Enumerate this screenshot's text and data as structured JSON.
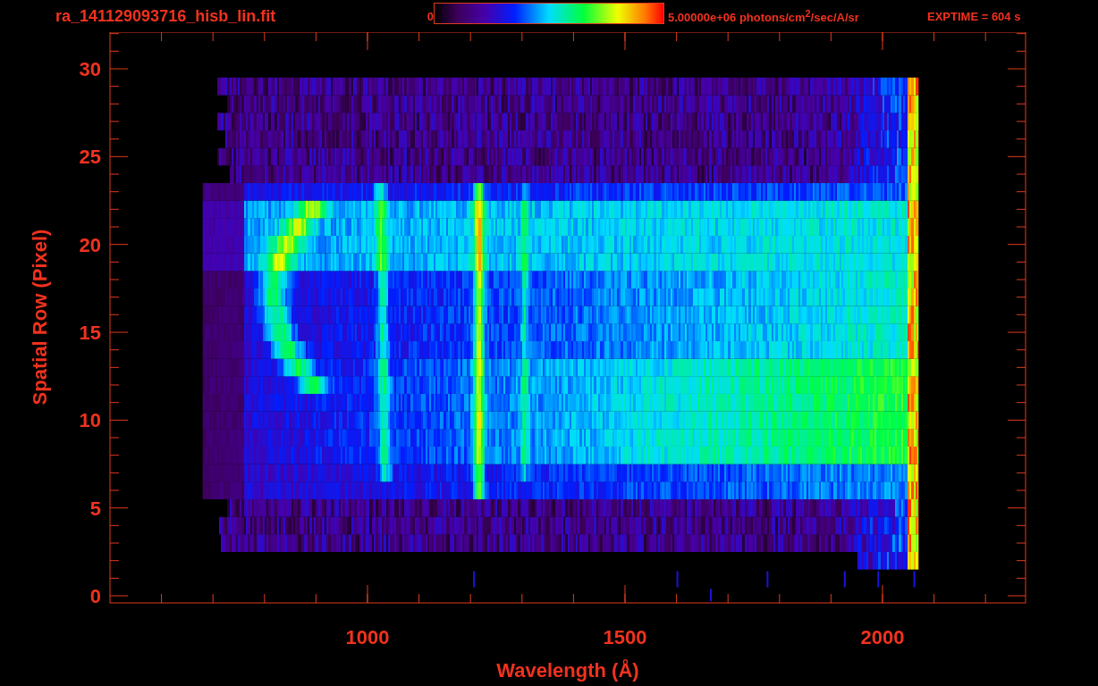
{
  "header": {
    "file_name": "ra_141129093716_hisb_lin.fit",
    "colorbar": {
      "min_label": "0",
      "max_label": "5.00000e+06 photons/cm$^{2}$/sec/A/sr"
    },
    "exposure": "EXPTIME = 604 s"
  },
  "plot": {
    "x_axis": {
      "label": "Wavelength (Å)",
      "ticks": [
        "1000",
        "1500",
        "2000"
      ]
    },
    "y_axis": {
      "label": "Spatial Row (Pixel)",
      "ticks": [
        "30",
        "25",
        "20",
        "15",
        "10",
        "5",
        "0"
      ]
    }
  }
}
